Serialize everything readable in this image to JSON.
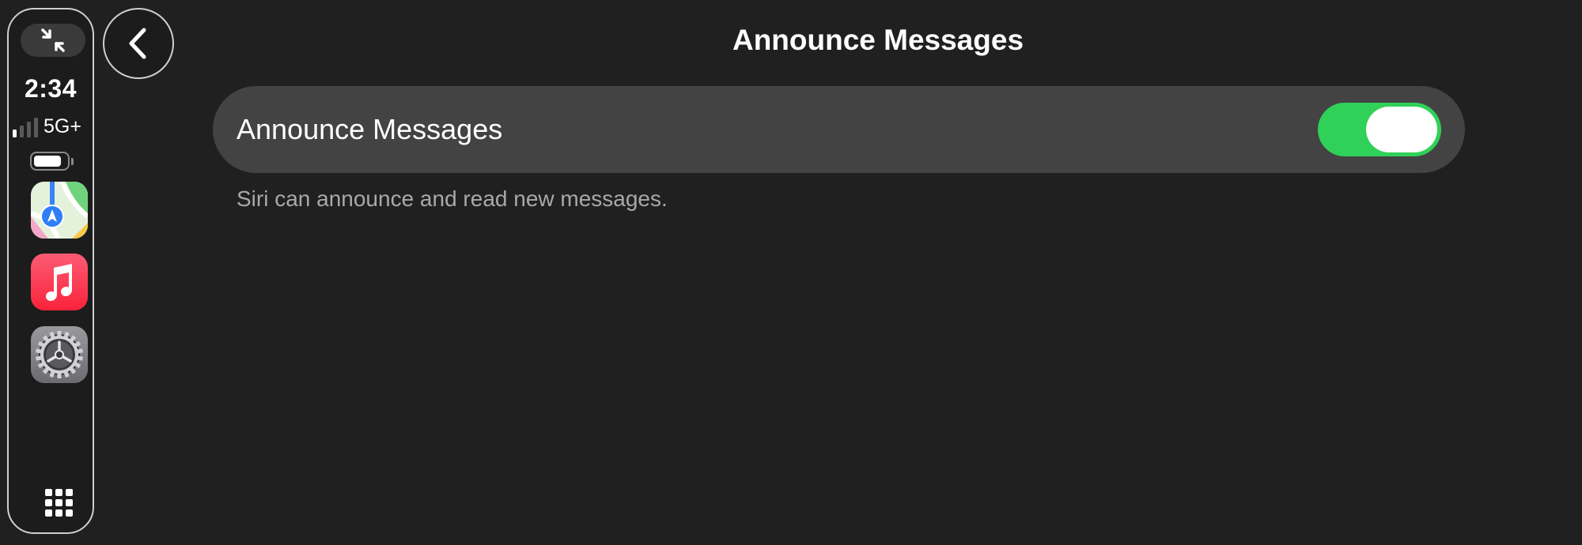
{
  "status": {
    "time": "2:34",
    "network": "5G+",
    "signal_level": 0.25,
    "battery_level": 0.85
  },
  "dock": {
    "apps": [
      {
        "name": "Maps",
        "icon": "maps-icon"
      },
      {
        "name": "Music",
        "icon": "music-icon"
      },
      {
        "name": "Settings",
        "icon": "settings-icon"
      }
    ],
    "shrink_icon": "shrink-arrows-icon",
    "grid_icon": "app-grid-icon"
  },
  "header": {
    "back_icon": "chevron-left-icon",
    "title": "Announce Messages"
  },
  "settings": {
    "toggle_row": {
      "label": "Announce Messages",
      "enabled": true
    },
    "footnote": "Siri can announce and read new messages."
  },
  "colors": {
    "background": "#202020",
    "row_background": "#434343",
    "toggle_on": "#30d158",
    "footnote_text": "#a9a9a9"
  }
}
